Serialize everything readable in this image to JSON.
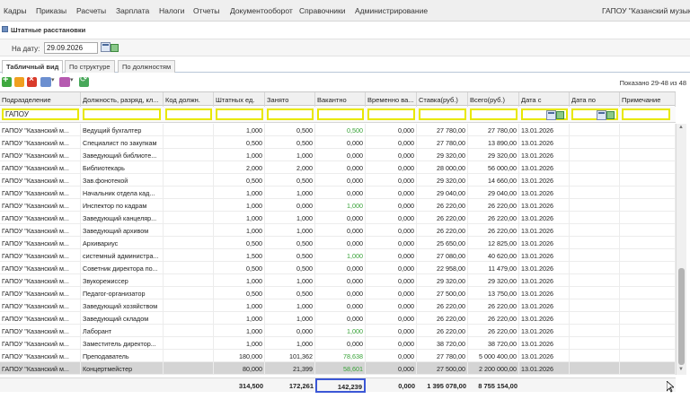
{
  "menu": {
    "items": [
      "Кадры",
      "Приказы",
      "Расчеты",
      "Зарплата",
      "Налоги",
      "Отчеты",
      "Документооборот",
      "Справочники",
      "Администрирование"
    ],
    "org": "ГАПОУ \"Казанский музыка"
  },
  "window": {
    "title": "Штатные расстановки"
  },
  "date": {
    "label": "На дату:",
    "value": "29.09.2026"
  },
  "tabs": [
    "Табличный вид",
    "По структуре",
    "По должностям"
  ],
  "status": {
    "shown": "Показано 29-48 из 48"
  },
  "columns": [
    "Подразделение",
    "Должность, разряд, кл...",
    "Код должн.",
    "Штатных ед.",
    "Занято",
    "Вакантно",
    "Временно ва...",
    "Ставка(руб.)",
    "Всего(руб.)",
    "Дата с",
    "Дата по",
    "Примечание"
  ],
  "filter": {
    "department": "ГАПОУ"
  },
  "rows": [
    {
      "dept": "ГАПОУ \"Казанский м...",
      "pos": "Ведущий бухгалтер",
      "units": "1,000",
      "occ": "0,500",
      "vac": "0,500",
      "tmp": "0,000",
      "rate": "27 780,00",
      "total": "27 780,00",
      "from": "13.01.2026",
      "vac_green": true
    },
    {
      "dept": "ГАПОУ \"Казанский м...",
      "pos": "Специалист по закупкам",
      "units": "0,500",
      "occ": "0,500",
      "vac": "0,000",
      "tmp": "0,000",
      "rate": "27 780,00",
      "total": "13 890,00",
      "from": "13.01.2026",
      "vac_green": false
    },
    {
      "dept": "ГАПОУ \"Казанский м...",
      "pos": "Заведующий библиоте...",
      "units": "1,000",
      "occ": "1,000",
      "vac": "0,000",
      "tmp": "0,000",
      "rate": "29 320,00",
      "total": "29 320,00",
      "from": "13.01.2026",
      "vac_green": false
    },
    {
      "dept": "ГАПОУ \"Казанский м...",
      "pos": "Библиотекарь",
      "units": "2,000",
      "occ": "2,000",
      "vac": "0,000",
      "tmp": "0,000",
      "rate": "28 000,00",
      "total": "56 000,00",
      "from": "13.01.2026",
      "vac_green": false
    },
    {
      "dept": "ГАПОУ \"Казанский м...",
      "pos": "Зав.фонотекой",
      "units": "0,500",
      "occ": "0,500",
      "vac": "0,000",
      "tmp": "0,000",
      "rate": "29 320,00",
      "total": "14 660,00",
      "from": "13.01.2026",
      "vac_green": false
    },
    {
      "dept": "ГАПОУ \"Казанский м...",
      "pos": "Начальник отдела кад...",
      "units": "1,000",
      "occ": "1,000",
      "vac": "0,000",
      "tmp": "0,000",
      "rate": "29 040,00",
      "total": "29 040,00",
      "from": "13.01.2026",
      "vac_green": false
    },
    {
      "dept": "ГАПОУ \"Казанский м...",
      "pos": "Инспектор по кадрам",
      "units": "1,000",
      "occ": "0,000",
      "vac": "1,000",
      "tmp": "0,000",
      "rate": "26 220,00",
      "total": "26 220,00",
      "from": "13.01.2026",
      "vac_green": true
    },
    {
      "dept": "ГАПОУ \"Казанский м...",
      "pos": "Заведующий канцеляр...",
      "units": "1,000",
      "occ": "1,000",
      "vac": "0,000",
      "tmp": "0,000",
      "rate": "26 220,00",
      "total": "26 220,00",
      "from": "13.01.2026",
      "vac_green": false
    },
    {
      "dept": "ГАПОУ \"Казанский м...",
      "pos": "Заведующий архивом",
      "units": "1,000",
      "occ": "1,000",
      "vac": "0,000",
      "tmp": "0,000",
      "rate": "26 220,00",
      "total": "26 220,00",
      "from": "13.01.2026",
      "vac_green": false
    },
    {
      "dept": "ГАПОУ \"Казанский м...",
      "pos": "Архивариус",
      "units": "0,500",
      "occ": "0,500",
      "vac": "0,000",
      "tmp": "0,000",
      "rate": "25 650,00",
      "total": "12 825,00",
      "from": "13.01.2026",
      "vac_green": false
    },
    {
      "dept": "ГАПОУ \"Казанский м...",
      "pos": "системный администра...",
      "units": "1,500",
      "occ": "0,500",
      "vac": "1,000",
      "tmp": "0,000",
      "rate": "27 080,00",
      "total": "40 620,00",
      "from": "13.01.2026",
      "vac_green": true
    },
    {
      "dept": "ГАПОУ \"Казанский м...",
      "pos": "Советник директора по...",
      "units": "0,500",
      "occ": "0,500",
      "vac": "0,000",
      "tmp": "0,000",
      "rate": "22 958,00",
      "total": "11 479,00",
      "from": "13.01.2026",
      "vac_green": false
    },
    {
      "dept": "ГАПОУ \"Казанский м...",
      "pos": "Звукорежиссер",
      "units": "1,000",
      "occ": "1,000",
      "vac": "0,000",
      "tmp": "0,000",
      "rate": "29 320,00",
      "total": "29 320,00",
      "from": "13.01.2026",
      "vac_green": false
    },
    {
      "dept": "ГАПОУ \"Казанский м...",
      "pos": "Педагог-организатор",
      "units": "0,500",
      "occ": "0,500",
      "vac": "0,000",
      "tmp": "0,000",
      "rate": "27 500,00",
      "total": "13 750,00",
      "from": "13.01.2026",
      "vac_green": false
    },
    {
      "dept": "ГАПОУ \"Казанский м...",
      "pos": "Заведующий хозяйством",
      "units": "1,000",
      "occ": "1,000",
      "vac": "0,000",
      "tmp": "0,000",
      "rate": "26 220,00",
      "total": "26 220,00",
      "from": "13.01.2026",
      "vac_green": false
    },
    {
      "dept": "ГАПОУ \"Казанский м...",
      "pos": "Заведующий складом",
      "units": "1,000",
      "occ": "1,000",
      "vac": "0,000",
      "tmp": "0,000",
      "rate": "26 220,00",
      "total": "26 220,00",
      "from": "13.01.2026",
      "vac_green": false
    },
    {
      "dept": "ГАПОУ \"Казанский м...",
      "pos": "Лаборант",
      "units": "1,000",
      "occ": "0,000",
      "vac": "1,000",
      "tmp": "0,000",
      "rate": "26 220,00",
      "total": "26 220,00",
      "from": "13.01.2026",
      "vac_green": true
    },
    {
      "dept": "ГАПОУ \"Казанский м...",
      "pos": "Заместитель директор...",
      "units": "1,000",
      "occ": "1,000",
      "vac": "0,000",
      "tmp": "0,000",
      "rate": "38 720,00",
      "total": "38 720,00",
      "from": "13.01.2026",
      "vac_green": false
    },
    {
      "dept": "ГАПОУ \"Казанский м...",
      "pos": "Преподаватель",
      "units": "180,000",
      "occ": "101,362",
      "vac": "78,638",
      "tmp": "0,000",
      "rate": "27 780,00",
      "total": "5 000 400,00",
      "from": "13.01.2026",
      "vac_green": true
    },
    {
      "dept": "ГАПОУ \"Казанский м...",
      "pos": "Концертмейстер",
      "units": "80,000",
      "occ": "21,399",
      "vac": "58,601",
      "tmp": "0,000",
      "rate": "27 500,00",
      "total": "2 200 000,00",
      "from": "13.01.2026",
      "vac_green": true
    }
  ],
  "selected_row": 19,
  "totals": {
    "units": "314,500",
    "occ": "172,261",
    "vac": "142,239",
    "tmp": "0,000",
    "rate": "1 395 078,00",
    "total": "8 755 154,00"
  }
}
